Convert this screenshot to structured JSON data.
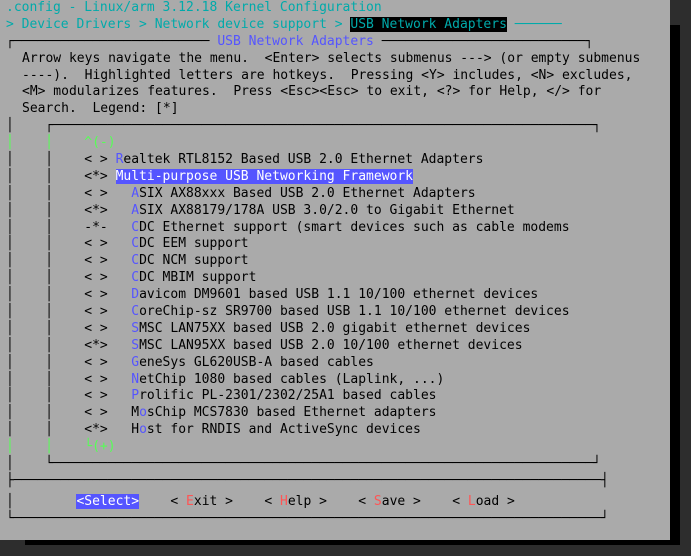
{
  "title_line1": ".config - Linux/arm 3.12.18 Kernel Configuration",
  "breadcrumb_prefix": "> Device Drivers > Network device support > ",
  "breadcrumb_current": "USB Network Adapters",
  "breadcrumb_suffix": " ──────",
  "dialog_title": "USB Network Adapters",
  "help_text": "Arrow keys navigate the menu.  <Enter> selects submenus ---> (or empty submenus ----).  Highlighted letters are hotkeys.  Pressing <Y> includes, <N> excludes, <M> modularizes features.  Press <Esc><Esc> to exit, <?> for Help, </> for Search.  Legend: [*]",
  "menu": [
    {
      "sym": "< >",
      "indent": 0,
      "hk": "R",
      "rest": "ealtek RTL8152 Based USB 2.0 Ethernet Adapters",
      "sel": false
    },
    {
      "sym": "<*>",
      "indent": 0,
      "hk": "M",
      "pre": "",
      "mid": "u",
      "rest": "lti-purpose USB Networking Framework",
      "sel": true
    },
    {
      "sym": "< >",
      "indent": 2,
      "hk": "A",
      "rest": "SIX AX88xxx Based USB 2.0 Ethernet Adapters",
      "sel": false
    },
    {
      "sym": "<*>",
      "indent": 2,
      "hk": "A",
      "rest": "SIX AX88179/178A USB 3.0/2.0 to Gigabit Ethernet",
      "sel": false
    },
    {
      "sym": "-*-",
      "indent": 2,
      "hk": "C",
      "rest": "DC Ethernet support (smart devices such as cable modems",
      "sel": false
    },
    {
      "sym": "< >",
      "indent": 2,
      "hk": "C",
      "rest": "DC EEM support",
      "sel": false
    },
    {
      "sym": "< >",
      "indent": 2,
      "hk": "C",
      "rest": "DC NCM support",
      "sel": false
    },
    {
      "sym": "< >",
      "indent": 2,
      "hk": "C",
      "rest": "DC MBIM support",
      "sel": false
    },
    {
      "sym": "< >",
      "indent": 2,
      "hk": "D",
      "rest": "avicom DM9601 based USB 1.1 10/100 ethernet devices",
      "sel": false
    },
    {
      "sym": "< >",
      "indent": 2,
      "hk": "C",
      "rest": "oreChip-sz SR9700 based USB 1.1 10/100 ethernet devices",
      "sel": false
    },
    {
      "sym": "< >",
      "indent": 2,
      "hk": "S",
      "rest": "MSC LAN75XX based USB 2.0 gigabit ethernet devices",
      "sel": false
    },
    {
      "sym": "<*>",
      "indent": 2,
      "hk": "S",
      "rest": "MSC LAN95XX based USB 2.0 10/100 ethernet devices",
      "sel": false
    },
    {
      "sym": "< >",
      "indent": 2,
      "hk": "G",
      "rest": "eneSys GL620USB-A based cables",
      "sel": false
    },
    {
      "sym": "< >",
      "indent": 2,
      "hk": "N",
      "rest": "etChip 1080 based cables (Laplink, ...)",
      "sel": false
    },
    {
      "sym": "< >",
      "indent": 2,
      "hk": "P",
      "rest": "rolific PL-2301/2302/25A1 based cables",
      "sel": false
    },
    {
      "sym": "< >",
      "indent": 2,
      "hk": "M",
      "pre": "",
      "mid": "o",
      "rest": "sChip MCS7830 based Ethernet adapters",
      "sel": false
    },
    {
      "sym": "<*>",
      "indent": 2,
      "hk": "H",
      "pre": "",
      "mid": "o",
      "rest": "st for RNDIS and ActiveSync devices",
      "sel": false
    }
  ],
  "buttons": {
    "select": {
      "l": "<",
      "k": "S",
      "r": "elect>",
      "sel": true
    },
    "exit": {
      "l": "< ",
      "k": "E",
      "r": "xit >",
      "sel": false
    },
    "help": {
      "l": "< ",
      "k": "H",
      "r": "elp >",
      "sel": false
    },
    "save": {
      "l": "< ",
      "k": "S",
      "r": "ave >",
      "sel": false
    },
    "load": {
      "l": "< ",
      "k": "L",
      "r": "oad >",
      "sel": false
    }
  },
  "scroll_up": "^(-)",
  "scroll_down": "└(+)"
}
